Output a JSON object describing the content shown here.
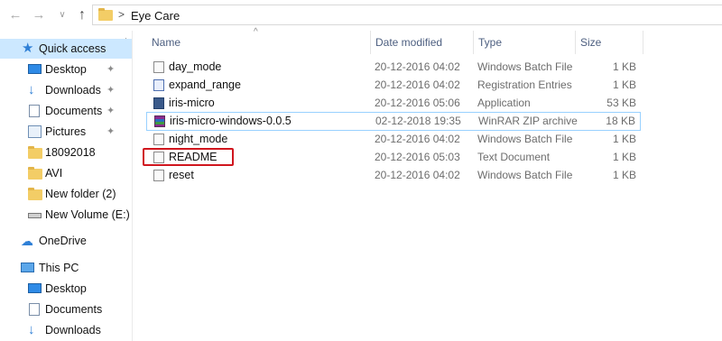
{
  "address": {
    "path": "Eye Care",
    "separator": ">"
  },
  "nav_buttons": {
    "back": "←",
    "forward": "→",
    "recent": "∨",
    "up": "↑"
  },
  "sidebar": {
    "items": [
      {
        "label": "Quick access",
        "icon": "star-icon",
        "pinned": false,
        "selected": true
      },
      {
        "label": "Desktop",
        "icon": "desktop-icon",
        "pinned": true
      },
      {
        "label": "Downloads",
        "icon": "download-icon",
        "pinned": true
      },
      {
        "label": "Documents",
        "icon": "documents-icon",
        "pinned": true
      },
      {
        "label": "Pictures",
        "icon": "pictures-icon",
        "pinned": true
      },
      {
        "label": "18092018",
        "icon": "folder-icon"
      },
      {
        "label": "AVI",
        "icon": "folder-icon"
      },
      {
        "label": "New folder (2)",
        "icon": "folder-icon"
      },
      {
        "label": "New Volume (E:)",
        "icon": "drive-icon"
      },
      {
        "label": "OneDrive",
        "icon": "onedrive-icon"
      },
      {
        "label": "This PC",
        "icon": "this-pc-icon"
      },
      {
        "label": "Desktop",
        "icon": "desktop-icon"
      },
      {
        "label": "Documents",
        "icon": "documents-icon"
      },
      {
        "label": "Downloads",
        "icon": "download-icon"
      }
    ]
  },
  "columns": {
    "name": "Name",
    "date": "Date modified",
    "type": "Type",
    "size": "Size"
  },
  "files": [
    {
      "name": "day_mode",
      "date": "20-12-2016 04:02",
      "type": "Windows Batch File",
      "size": "1 KB",
      "icon": "batch-file-icon"
    },
    {
      "name": "expand_range",
      "date": "20-12-2016 04:02",
      "type": "Registration Entries",
      "size": "1 KB",
      "icon": "registry-file-icon"
    },
    {
      "name": "iris-micro",
      "date": "20-12-2016 05:06",
      "type": "Application",
      "size": "53 KB",
      "icon": "application-icon"
    },
    {
      "name": "iris-micro-windows-0.0.5",
      "date": "02-12-2018 19:35",
      "type": "WinRAR ZIP archive",
      "size": "18 KB",
      "icon": "zip-archive-icon"
    },
    {
      "name": "night_mode",
      "date": "20-12-2016 04:02",
      "type": "Windows Batch File",
      "size": "1 KB",
      "icon": "batch-file-icon"
    },
    {
      "name": "README",
      "date": "20-12-2016 05:03",
      "type": "Text Document",
      "size": "1 KB",
      "icon": "text-file-icon"
    },
    {
      "name": "reset",
      "date": "20-12-2016 04:02",
      "type": "Windows Batch File",
      "size": "1 KB",
      "icon": "batch-file-icon"
    }
  ],
  "colors": {
    "selection": "#cce8ff",
    "highlight_box": "#d0161e",
    "accent": "#2e7fd6"
  }
}
